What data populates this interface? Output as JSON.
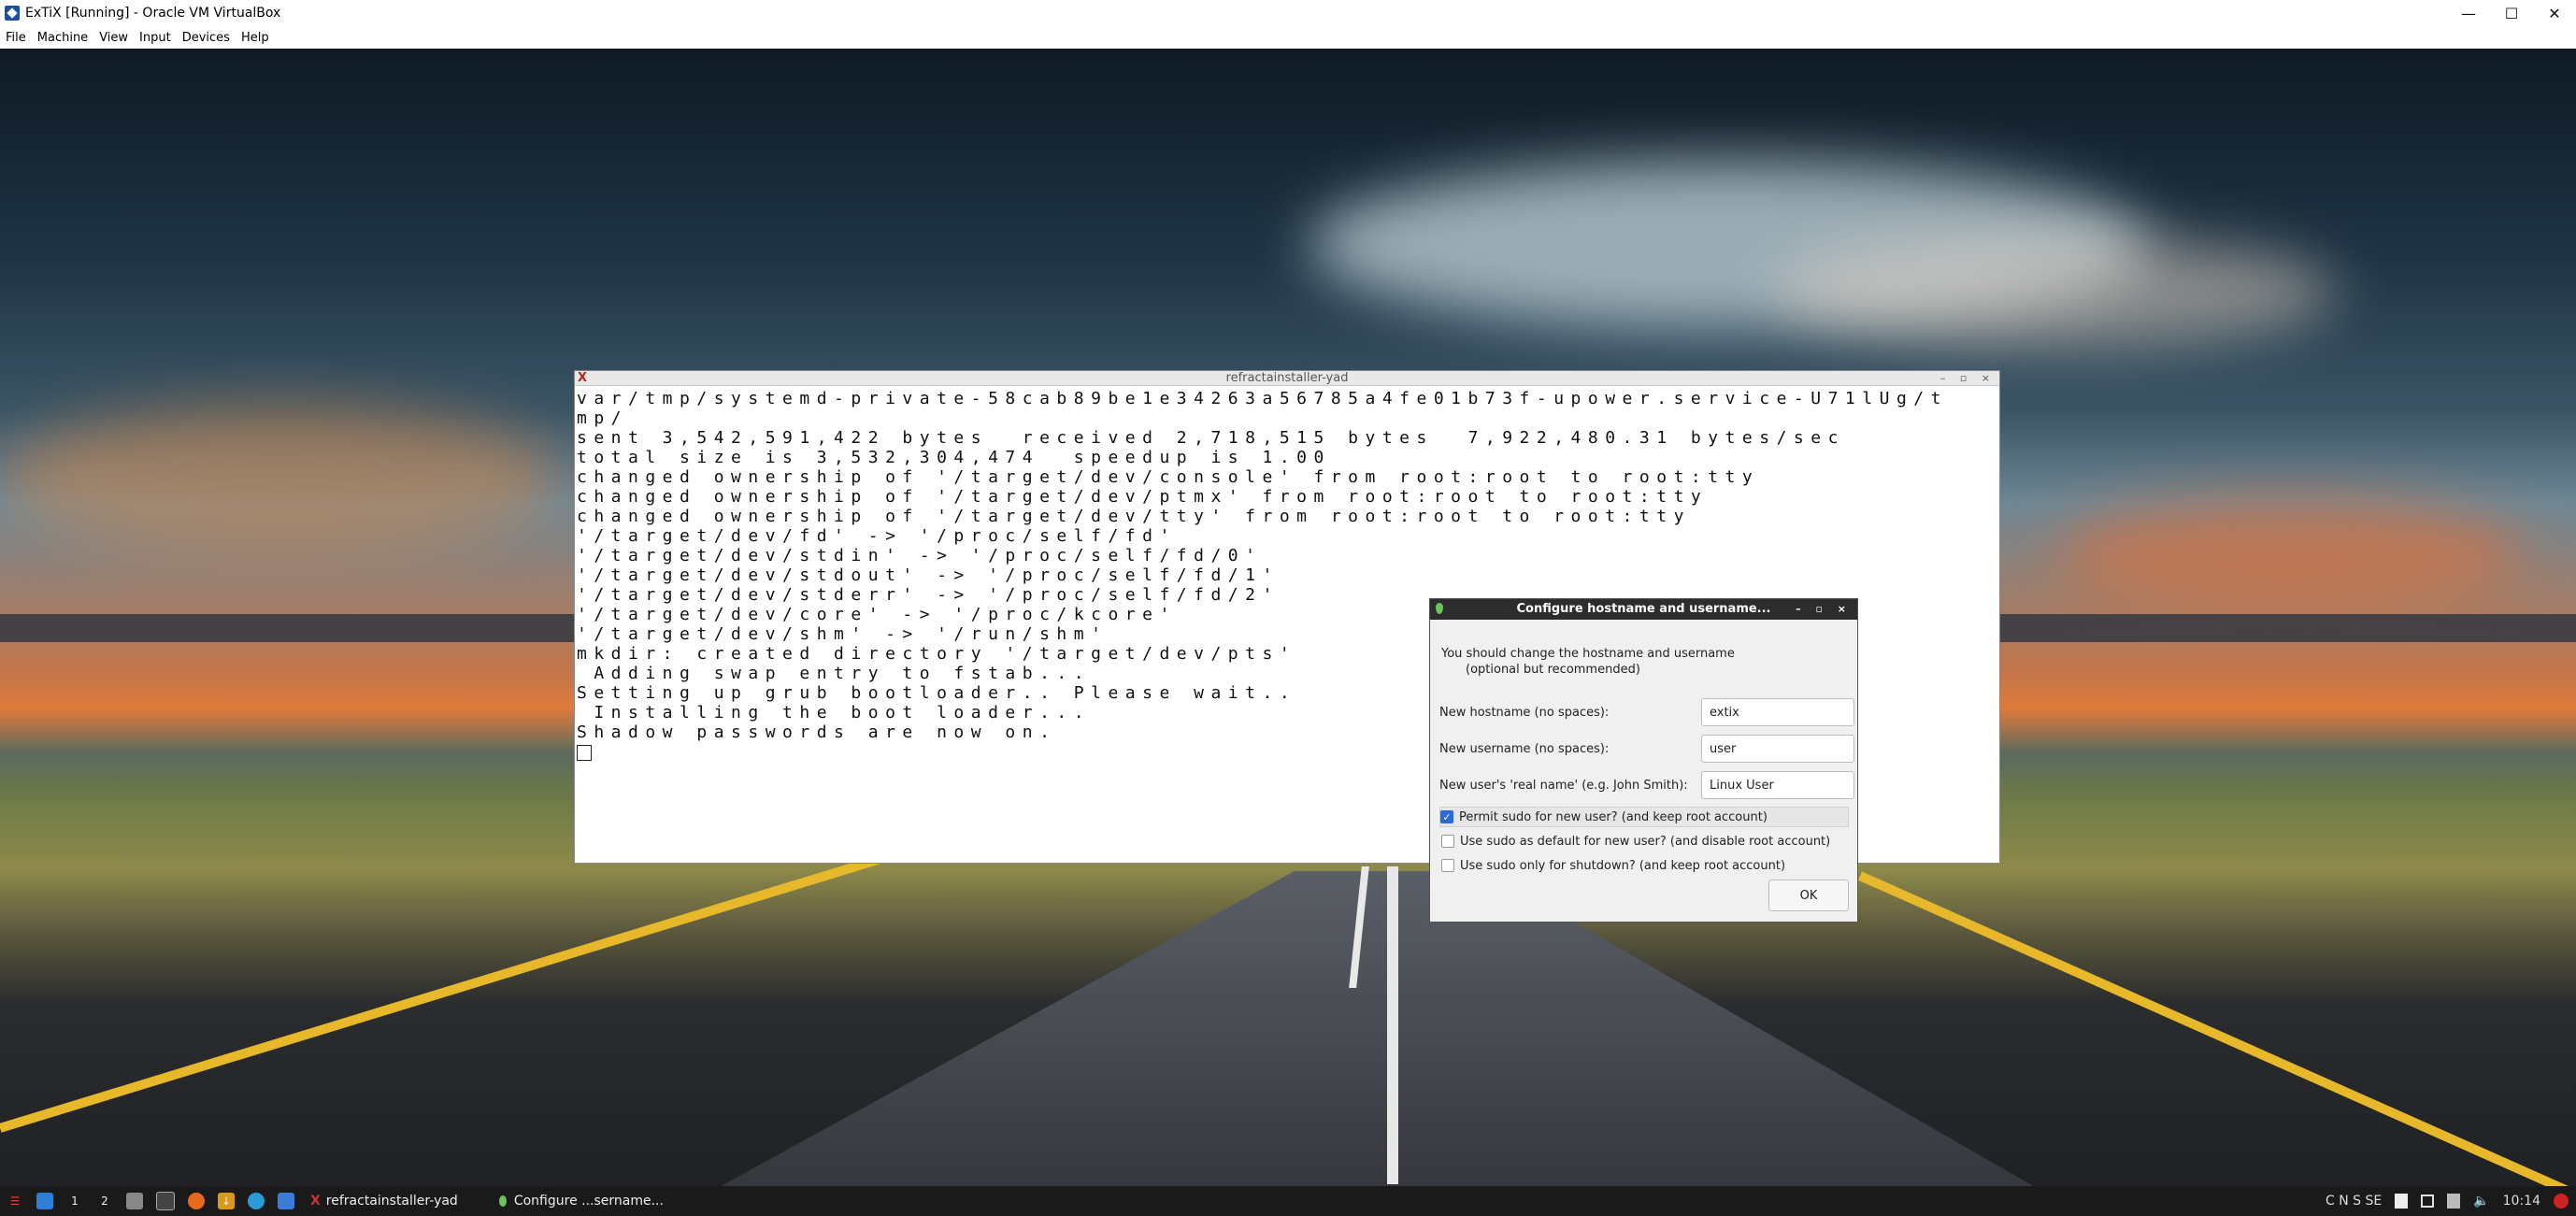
{
  "host": {
    "title": "ExTiX [Running] - Oracle VM VirtualBox",
    "menu": [
      "File",
      "Machine",
      "View",
      "Input",
      "Devices",
      "Help"
    ],
    "controls": [
      "—",
      "☐",
      "✕"
    ]
  },
  "terminal": {
    "title": "refractainstaller-yad",
    "lines": [
      "var/tmp/systemd-private-58cab89be1e34263a56785a4fe01b73f-upower.service-U71lUg/t",
      "mp/",
      "",
      "sent 3,542,591,422 bytes  received 2,718,515 bytes  7,922,480.31 bytes/sec",
      "total size is 3,532,304,474  speedup is 1.00",
      "changed ownership of '/target/dev/console' from root:root to root:tty",
      "changed ownership of '/target/dev/ptmx' from root:root to root:tty",
      "changed ownership of '/target/dev/tty' from root:root to root:tty",
      "'/target/dev/fd' -> '/proc/self/fd'",
      "'/target/dev/stdin' -> '/proc/self/fd/0'",
      "'/target/dev/stdout' -> '/proc/self/fd/1'",
      "'/target/dev/stderr' -> '/proc/self/fd/2'",
      "'/target/dev/core' -> '/proc/kcore'",
      "'/target/dev/shm' -> '/run/shm'",
      "mkdir: created directory '/target/dev/pts'",
      "",
      " Adding swap entry to fstab...",
      "",
      "Setting up grub bootloader.. Please wait..",
      "",
      " Installing the boot loader...",
      "",
      "Shadow passwords are now on."
    ]
  },
  "dialog": {
    "title": "Configure hostname and username...",
    "message": "You should change the hostname and username",
    "message_sub": "(optional but recommended)",
    "hostname_label": "New hostname (no spaces):",
    "hostname_value": "extix",
    "username_label": "New username (no spaces):",
    "username_value": "user",
    "realname_label": "New user's 'real name' (e.g. John Smith):",
    "realname_value": "Linux User",
    "checkboxes": [
      {
        "label": "Permit sudo for new user? (and keep root account)",
        "checked": true
      },
      {
        "label": "Use sudo as default for new user? (and disable root account)",
        "checked": false
      },
      {
        "label": "Use sudo only for shutdown? (and keep root account)",
        "checked": false
      }
    ],
    "ok_label": "OK"
  },
  "taskbar": {
    "workspaces": [
      "1",
      "2"
    ],
    "tasks": [
      "refractainstaller-yad",
      "Configure ...sername..."
    ],
    "tray_keys": "C N S SE",
    "clock": "10:14"
  }
}
